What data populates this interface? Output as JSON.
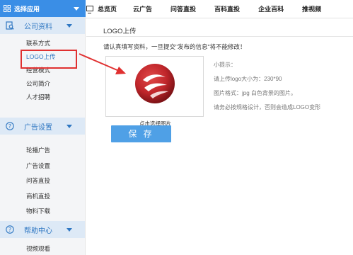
{
  "topbar": {
    "app_select_label": "选择应用",
    "nav": [
      "总览页",
      "云广告",
      "问答直投",
      "百科直投",
      "企业百科",
      "推视频"
    ]
  },
  "sidebar": {
    "sections": [
      {
        "title": "公司资料",
        "items": [
          "联系方式",
          "LOGO上传",
          "经营模式",
          "公司简介",
          "人才招聘"
        ],
        "active_index": 1
      },
      {
        "title": "广告设置",
        "items": [
          "轮播广告",
          "广告设置",
          "问答直投",
          "商机直投",
          "物料下载"
        ]
      },
      {
        "title": "帮助中心",
        "items": [
          "视频观看"
        ]
      }
    ]
  },
  "main": {
    "title": "LOGO上传",
    "notice": "请认真填写资料，一旦提交\"发布的信息\"将不能修改！",
    "logo_caption": "点击选择图片",
    "hints": [
      "小提示：",
      "请上传logo大小为：230*90",
      "图片格式：jpg  白色背景的图片。",
      "请务必按规格设计，否则会造成LOGO变形"
    ],
    "save_label": "保 存"
  },
  "colors": {
    "accent": "#3a8ee6",
    "section_bg": "#dde9f6",
    "section_text": "#2f77c2",
    "highlight_red": "#e03030",
    "save_button": "#4fa0e6",
    "logo_red": "#c0262b"
  }
}
